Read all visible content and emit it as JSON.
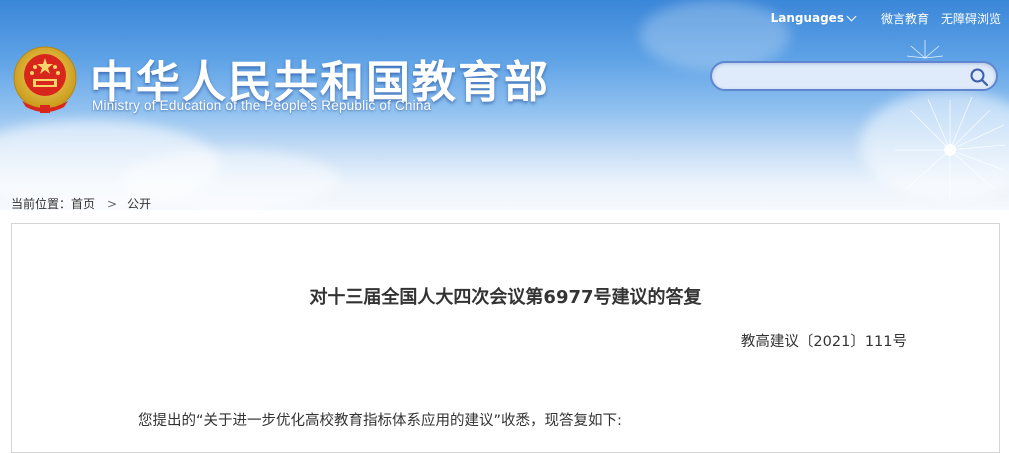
{
  "header": {
    "title_cn": "中华人民共和国教育部",
    "title_en": "Ministry of Education of the People's Republic of China",
    "emblem_icon": "national-emblem-icon",
    "top_links": {
      "languages": "Languages",
      "weibo": "微言教育",
      "accessible": "无障碍浏览"
    },
    "search": {
      "placeholder": "",
      "value": "",
      "icon": "search-icon"
    }
  },
  "breadcrumb": {
    "prefix": "当前位置：",
    "home": "首页",
    "separator": ">",
    "current": "公开"
  },
  "document": {
    "title": "对十三届全国人大四次会议第6977号建议的答复",
    "number": "教高建议〔2021〕111号",
    "first_paragraph": "您提出的“关于进一步优化高校教育指标体系应用的建议”收悉，现答复如下:"
  },
  "colors": {
    "header_top": "#3a86d8",
    "header_bottom": "#f6f9fd",
    "search_border": "#5f86cf",
    "text": "#333333"
  }
}
